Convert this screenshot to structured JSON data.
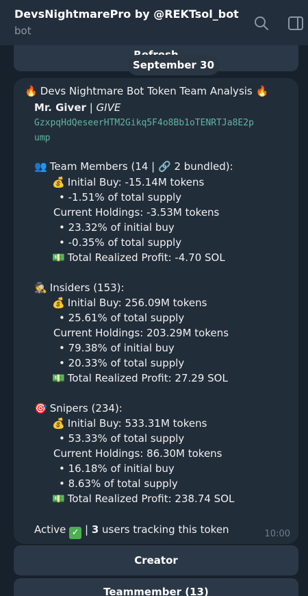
{
  "header": {
    "title": "DevsNightmarePro by @REKTsol_bot",
    "subtitle": "bot"
  },
  "keyboard_top": {
    "refresh_label": "Refresh"
  },
  "date_pill": "September 30",
  "message": {
    "title": "Devs Nightmare Bot Token Team Analysis",
    "token_name": "Mr. Giver",
    "separator": "|",
    "token_symbol": "GIVE",
    "address_line1": "GzxpqHdQeseerHTM2Gikq5F4o8Bb1oTENRTJa8E2p",
    "address_line2": "ump",
    "team": {
      "heading": "Team Members (14 | 🔗 2 bundled):",
      "initial_buy": "Initial Buy: -15.14M tokens",
      "initial_pct": "• -1.51% of total supply",
      "holdings": "Current Holdings: -3.53M tokens",
      "holdings_init": "• 23.32% of initial buy",
      "holdings_total": "• -0.35% of total supply",
      "profit": "Total Realized Profit: -4.70 SOL"
    },
    "insiders": {
      "heading": "Insiders (153):",
      "initial_buy": "Initial Buy: 256.09M tokens",
      "initial_pct": "• 25.61% of total supply",
      "holdings": "Current Holdings: 203.29M tokens",
      "holdings_init": "• 79.38% of initial buy",
      "holdings_total": "• 20.33% of total supply",
      "profit": "Total Realized Profit: 27.29 SOL"
    },
    "snipers": {
      "heading": "Snipers (234):",
      "initial_buy": "Initial Buy: 533.31M tokens",
      "initial_pct": "• 53.33% of total supply",
      "holdings": "Current Holdings: 86.30M tokens",
      "holdings_init": "• 16.18% of initial buy",
      "holdings_total": "• 8.63% of total supply",
      "profit": "Total Realized Profit: 238.74 SOL"
    },
    "status_active": "Active",
    "status_sep": "|",
    "users_count": "3",
    "users_text": "users tracking this token",
    "time": "10:00"
  },
  "keyboard_bottom": {
    "creator_label": "Creator",
    "team_label": "Teammember (13)"
  },
  "icons": {
    "search": "search-icon",
    "panel": "side-panel-icon",
    "fire": "fire-emoji",
    "people": "people-emoji",
    "money_bag": "money-bag-emoji",
    "banknote": "money-with-wings-emoji",
    "spy": "detective-emoji",
    "target": "target-emoji",
    "check": "check-mark-emoji"
  },
  "colors": {
    "background": "#17212b",
    "header": "#232e3c",
    "bubble": "#222d3a",
    "button": "#2b3847",
    "address": "#5fb7a0",
    "muted": "#8a97a5"
  }
}
